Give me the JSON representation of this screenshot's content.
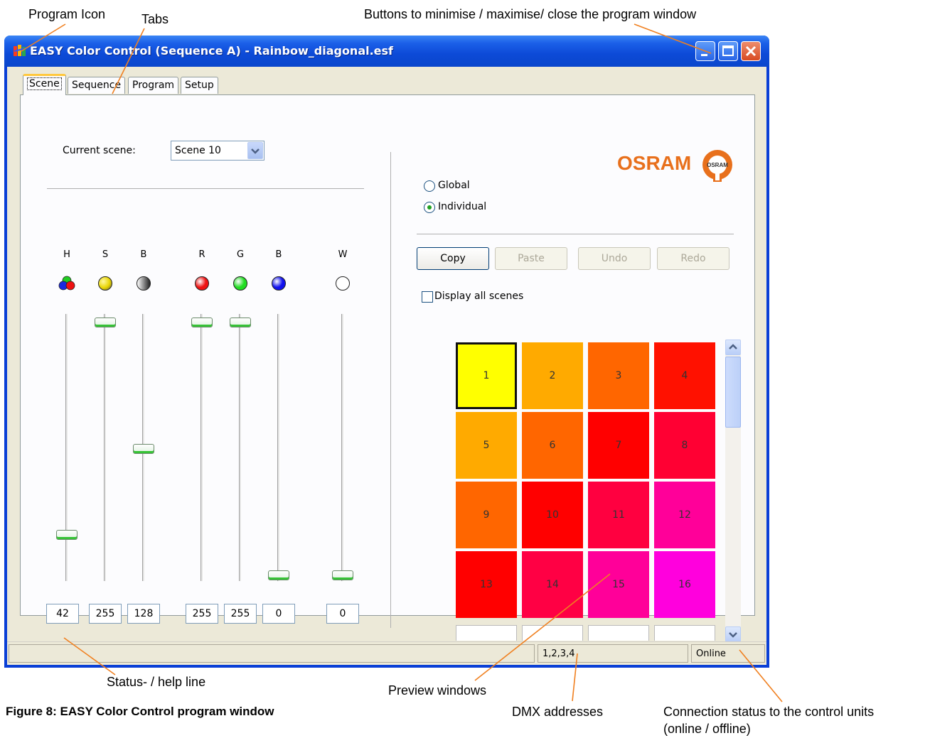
{
  "annotations": {
    "program_icon": "Program Icon",
    "tabs": "Tabs",
    "window_buttons": "Buttons to minimise / maximise/ close the program window",
    "status_line": "Status- / help line",
    "preview_windows": "Preview windows",
    "dmx_addresses": "DMX addresses",
    "connection_status_1": "Connection status to the control units",
    "connection_status_2": "(online / offline)"
  },
  "caption": "Figure 8: EASY Color Control program window",
  "window": {
    "title": "EASY Color Control (Sequence A) - Rainbow_diagonal.esf"
  },
  "tabs": [
    "Scene",
    "Sequence",
    "Program",
    "Setup"
  ],
  "active_tab": "Scene",
  "scene_panel": {
    "current_scene_label": "Current scene:",
    "current_scene_value": "Scene 10",
    "channels": [
      {
        "label": "H",
        "value": "42",
        "level": 0.16,
        "icon": "hue-icon"
      },
      {
        "label": "S",
        "value": "255",
        "level": 1.0,
        "color": "#e8d400",
        "icon": "saturation-icon"
      },
      {
        "label": "B",
        "value": "128",
        "level": 0.5,
        "color": "#888888",
        "icon": "brightness-icon"
      },
      {
        "label": "R",
        "value": "255",
        "level": 1.0,
        "color": "#ee1111",
        "icon": "red-icon"
      },
      {
        "label": "G",
        "value": "255",
        "level": 1.0,
        "color": "#22dd22",
        "icon": "green-icon"
      },
      {
        "label": "B",
        "value": "0",
        "level": 0.0,
        "color": "#1111ee",
        "icon": "blue-icon"
      },
      {
        "label": "W",
        "value": "0",
        "level": 0.0,
        "color": "#ffffff",
        "icon": "white-icon"
      }
    ]
  },
  "preview_panel": {
    "brand": "OSRAM",
    "brand_color": "#e8701c",
    "mode_global": "Global",
    "mode_individual": "Individual",
    "selected_mode": "Individual",
    "buttons": {
      "copy": "Copy",
      "paste": "Paste",
      "undo": "Undo",
      "redo": "Redo"
    },
    "display_all_label": "Display all scenes",
    "display_all_checked": false,
    "cells": [
      {
        "label": "1",
        "color": "#ffff00",
        "selected": true
      },
      {
        "label": "2",
        "color": "#ffaa00"
      },
      {
        "label": "3",
        "color": "#ff6600"
      },
      {
        "label": "4",
        "color": "#ff1100"
      },
      {
        "label": "5",
        "color": "#ffaa00"
      },
      {
        "label": "6",
        "color": "#ff6600"
      },
      {
        "label": "7",
        "color": "#ff0000"
      },
      {
        "label": "8",
        "color": "#ff0033"
      },
      {
        "label": "9",
        "color": "#ff6600"
      },
      {
        "label": "10",
        "color": "#ff0000"
      },
      {
        "label": "11",
        "color": "#ff0040"
      },
      {
        "label": "12",
        "color": "#ff0099"
      },
      {
        "label": "13",
        "color": "#ff0000"
      },
      {
        "label": "14",
        "color": "#ff0044"
      },
      {
        "label": "15",
        "color": "#ff0099"
      },
      {
        "label": "16",
        "color": "#ff00dd"
      }
    ]
  },
  "status_bar": {
    "help_text": "",
    "dmx": "1,2,3,4",
    "connection": "Online"
  }
}
